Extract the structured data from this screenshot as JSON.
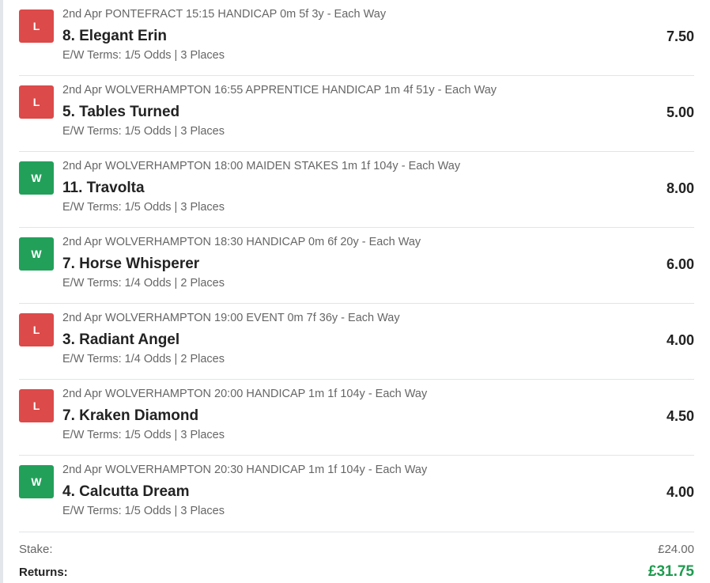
{
  "colors": {
    "loss": "#dc4a4a",
    "win": "#22a05a",
    "returns": "#1f9a4f"
  },
  "bets": [
    {
      "result": "L",
      "status": "loss",
      "race": "2nd Apr PONTEFRACT 15:15 HANDICAP 0m 5f 3y - Each Way",
      "selection": "8. Elegant Erin",
      "terms": "E/W Terms: 1/5 Odds | 3 Places",
      "odds": "7.50"
    },
    {
      "result": "L",
      "status": "loss",
      "race": "2nd Apr WOLVERHAMPTON 16:55 APPRENTICE HANDICAP 1m 4f 51y - Each Way",
      "selection": "5. Tables Turned",
      "terms": "E/W Terms: 1/5 Odds | 3 Places",
      "odds": "5.00"
    },
    {
      "result": "W",
      "status": "win",
      "race": "2nd Apr WOLVERHAMPTON 18:00 MAIDEN STAKES 1m 1f 104y - Each Way",
      "selection": "11. Travolta",
      "terms": "E/W Terms: 1/5 Odds | 3 Places",
      "odds": "8.00"
    },
    {
      "result": "W",
      "status": "win",
      "race": "2nd Apr WOLVERHAMPTON 18:30 HANDICAP 0m 6f 20y - Each Way",
      "selection": "7. Horse Whisperer",
      "terms": "E/W Terms: 1/4 Odds | 2 Places",
      "odds": "6.00"
    },
    {
      "result": "L",
      "status": "loss",
      "race": "2nd Apr WOLVERHAMPTON 19:00 EVENT 0m 7f 36y - Each Way",
      "selection": "3. Radiant Angel",
      "terms": "E/W Terms: 1/4 Odds | 2 Places",
      "odds": "4.00"
    },
    {
      "result": "L",
      "status": "loss",
      "race": "2nd Apr WOLVERHAMPTON 20:00 HANDICAP 1m 1f 104y - Each Way",
      "selection": "7. Kraken Diamond",
      "terms": "E/W Terms: 1/5 Odds | 3 Places",
      "odds": "4.50"
    },
    {
      "result": "W",
      "status": "win",
      "race": "2nd Apr WOLVERHAMPTON 20:30 HANDICAP 1m 1f 104y - Each Way",
      "selection": "4. Calcutta Dream",
      "terms": "E/W Terms: 1/5 Odds | 3 Places",
      "odds": "4.00"
    }
  ],
  "summary": {
    "stake_label": "Stake:",
    "stake_value": "£24.00",
    "returns_label": "Returns:",
    "returns_value": "£31.75"
  }
}
